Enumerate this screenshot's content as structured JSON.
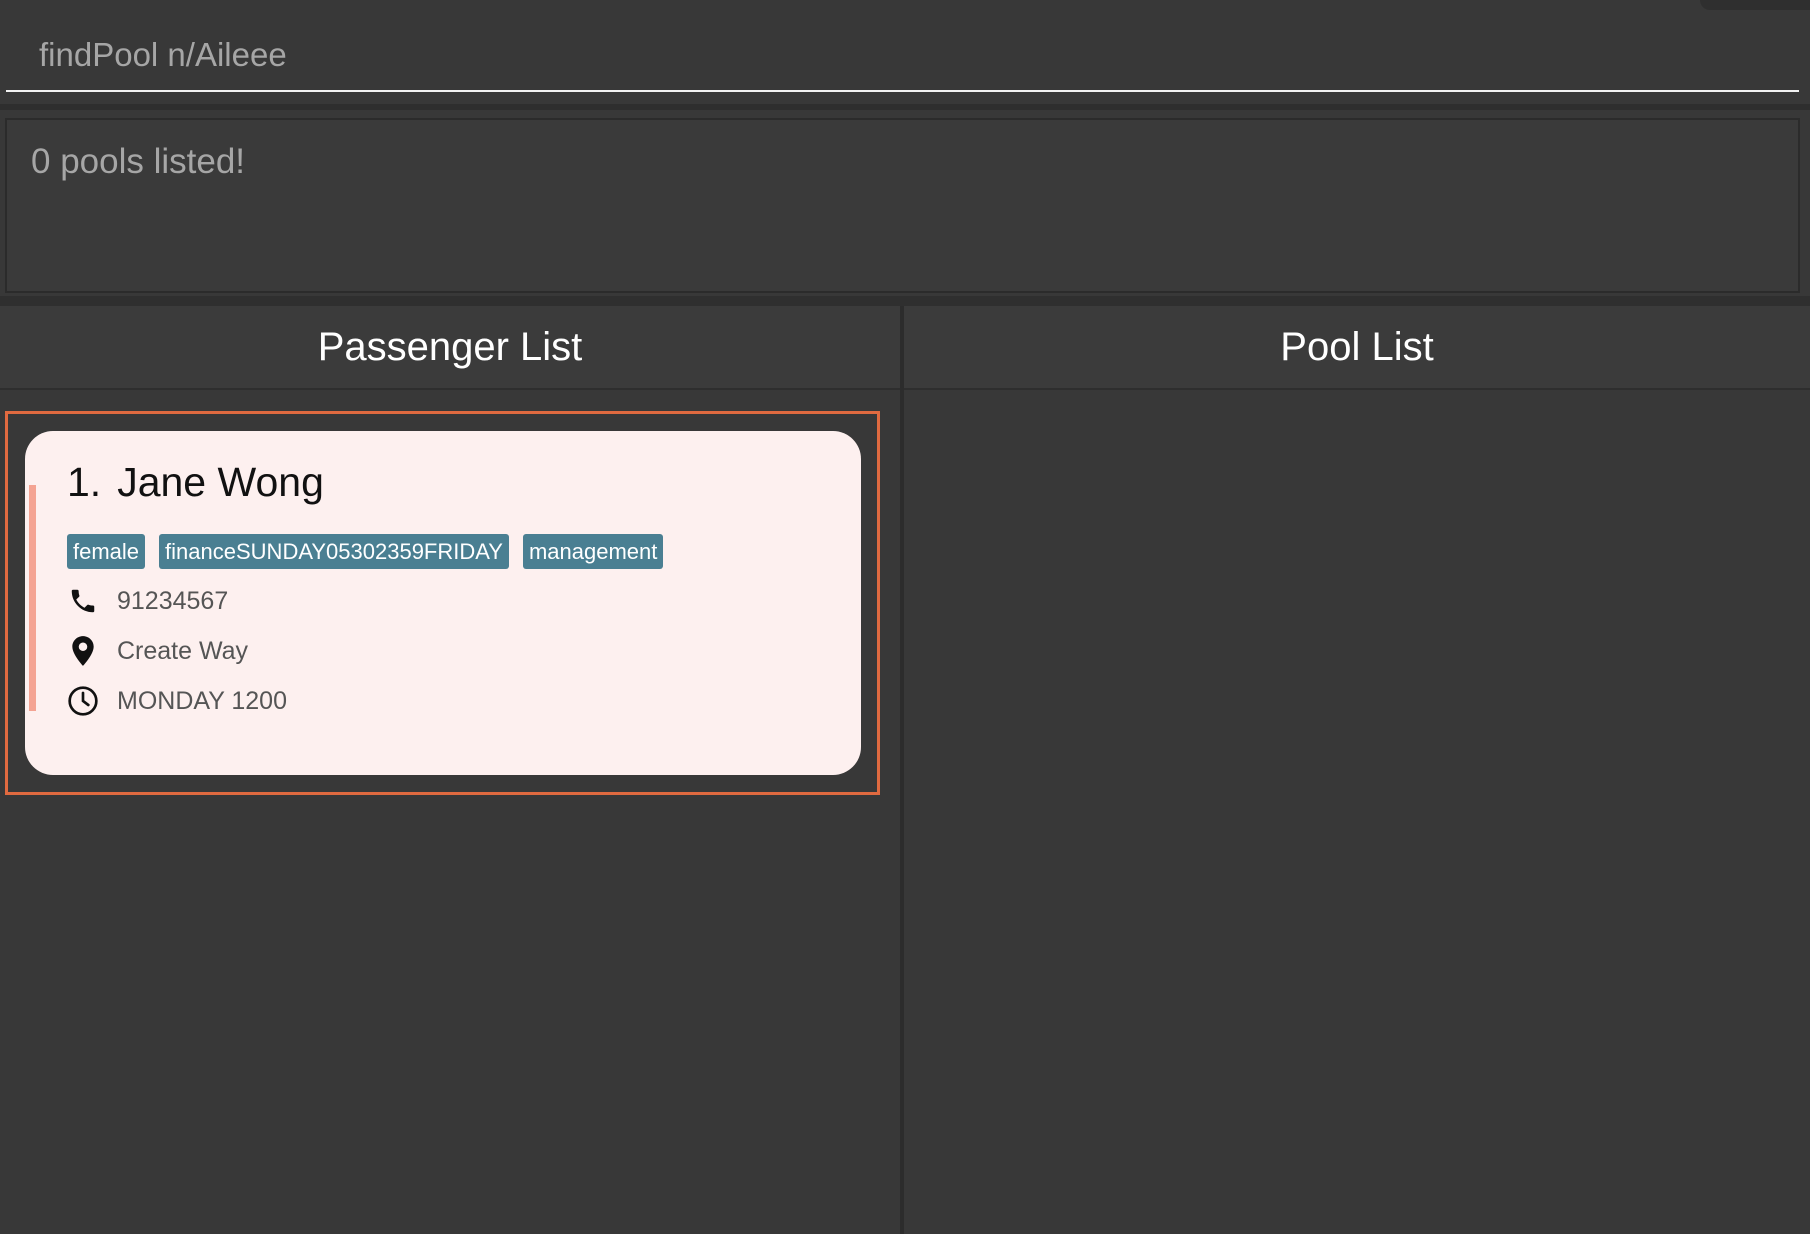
{
  "command_box": {
    "value": "findPool n/Aileee"
  },
  "result_display": {
    "message": "0 pools listed!"
  },
  "passenger_panel": {
    "title": "Passenger List",
    "passengers": [
      {
        "index": "1.",
        "name": "Jane Wong",
        "tags": [
          "female",
          "financeSUNDAY05302359FRIDAY",
          "management"
        ],
        "phone": "91234567",
        "address": "Create Way",
        "trip_time": "MONDAY 1200",
        "icons": [
          "phone-icon",
          "location-pin-icon",
          "clock-icon"
        ],
        "selected": true
      }
    ]
  },
  "pool_panel": {
    "title": "Pool List",
    "pools": []
  },
  "colors": {
    "background": "#383838",
    "selection_border": "#e06a40",
    "card_background": "#fdf0ef",
    "card_accent": "#f4a392",
    "tag_background": "#4a7f92"
  }
}
